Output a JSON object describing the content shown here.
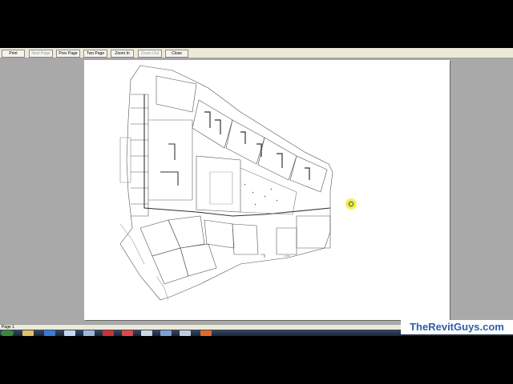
{
  "toolbar": {
    "print": "Print",
    "next_page": "Next Page",
    "prev_page": "Prev Page",
    "two_page": "Two Page",
    "zoom_in": "Zoom In",
    "zoom_out": "Zoom Out",
    "close": "Close"
  },
  "status": {
    "page": "Page 1"
  },
  "watermark": "TheRevitGuys.com",
  "taskbar": {
    "icons": [
      "start-icon",
      "ie-icon",
      "explorer-icon",
      "media-player-icon",
      "app-icon",
      "app-icon",
      "app-icon",
      "app-icon",
      "app-icon",
      "app-icon",
      "app-icon",
      "app-icon",
      "revit-icon"
    ]
  }
}
